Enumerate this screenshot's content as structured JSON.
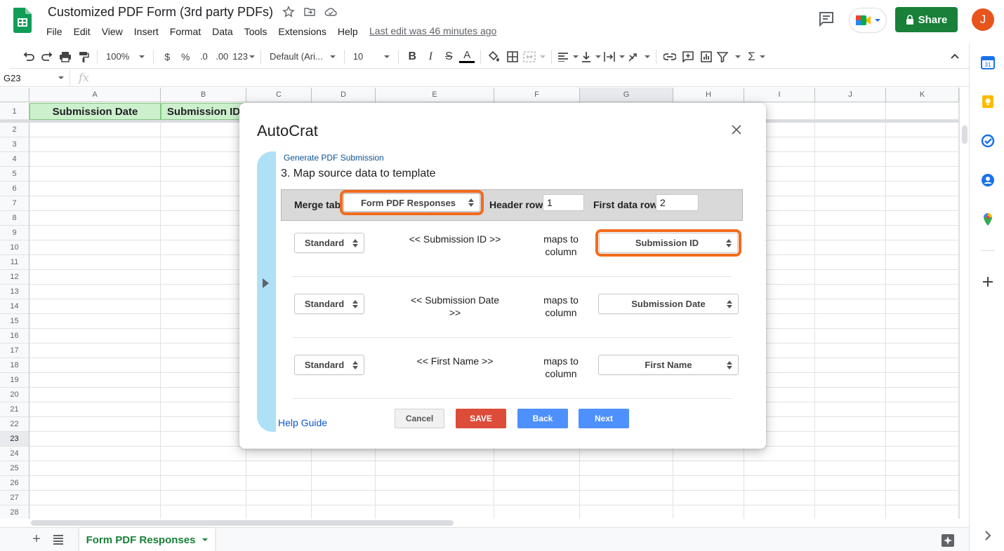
{
  "doc": {
    "title": "Customized PDF Form (3rd party PDFs)",
    "last_edit": "Last edit was 46 minutes ago"
  },
  "menu": [
    "File",
    "Edit",
    "View",
    "Insert",
    "Format",
    "Data",
    "Tools",
    "Extensions",
    "Help"
  ],
  "header": {
    "share_label": "Share",
    "avatar_initial": "J"
  },
  "toolbar": {
    "zoom": "100%",
    "currency": "$",
    "percent": "%",
    "dec_decrease": ".0",
    "dec_increase": ".00",
    "more_formats": "123",
    "font": "Default (Ari...",
    "font_size": "10",
    "bold": "B",
    "italic": "I",
    "strike": "S",
    "text_color": "A"
  },
  "formula_bar": {
    "cell_ref": "G23",
    "fx": "fx"
  },
  "grid": {
    "columns": [
      "A",
      "B",
      "C",
      "D",
      "E",
      "F",
      "G",
      "H",
      "I",
      "J",
      "K"
    ],
    "rows": [
      "1",
      "2",
      "3",
      "4",
      "5",
      "6",
      "7",
      "8",
      "9",
      "10",
      "11",
      "12",
      "13",
      "14",
      "15",
      "16",
      "17",
      "18",
      "19",
      "20",
      "21",
      "22",
      "23",
      "24",
      "25",
      "26",
      "27",
      "28"
    ],
    "header_cells": [
      "Submission Date",
      "Submission ID"
    ],
    "selected_row": "23",
    "selected_col": "G"
  },
  "sheet_tabs": {
    "active": "Form PDF Responses"
  },
  "dialog": {
    "title": "AutoCrat",
    "subtitle": "Generate PDF Submission",
    "step": "3. Map source data to template",
    "merge_tab_label": "Merge tab",
    "merge_tab_value": "Form PDF Responses",
    "header_row_label": "Header row",
    "header_row_value": "1",
    "first_data_row_label": "First data row",
    "first_data_row_value": "2",
    "maps_to": "maps to column",
    "mappings": [
      {
        "type": "Standard",
        "tag": "<< Submission ID >>",
        "column": "Submission ID"
      },
      {
        "type": "Standard",
        "tag": "<< Submission Date >>",
        "column": "Submission Date"
      },
      {
        "type": "Standard",
        "tag": "<< First Name >>",
        "column": "First Name"
      }
    ],
    "help_guide": "Help Guide",
    "buttons": {
      "cancel": "Cancel",
      "save": "SAVE",
      "back": "Back",
      "next": "Next"
    }
  },
  "colors": {
    "accent_green": "#188038",
    "highlight_orange": "#f26b1d",
    "save_red": "#dd4b39",
    "nav_blue": "#4d90fe",
    "header_fill": "#ccf0cc",
    "rail_blue": "#aee0f6"
  },
  "icons": {
    "star": "star-icon",
    "folder": "move-folder-icon",
    "cloud": "cloud-status-icon",
    "comment": "comment-history-icon",
    "meet": "meet-icon",
    "lock": "lock-icon",
    "close": "close-icon"
  }
}
